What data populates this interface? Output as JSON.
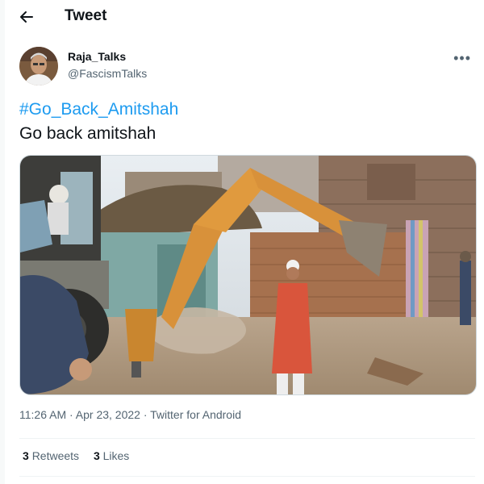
{
  "header": {
    "title": "Tweet",
    "back_icon": "arrow-left-icon"
  },
  "tweet": {
    "author": {
      "display_name": "Raja_Talks",
      "handle": "@FascismTalks"
    },
    "more_icon": "more-horizontal-icon",
    "hashtag": "#Go_Back_Amitshah",
    "text": "Go back amitshah",
    "timestamp": "11:26 AM · Apr 23, 2022 · ",
    "source": "Twitter for Android",
    "stats": {
      "retweets_count": "3",
      "retweets_label": "Retweets",
      "likes_count": "3",
      "likes_label": "Likes"
    }
  },
  "colors": {
    "link": "#1d9bf0",
    "text": "#0f1419",
    "secondary": "#536471",
    "divider": "#eff3f4"
  }
}
